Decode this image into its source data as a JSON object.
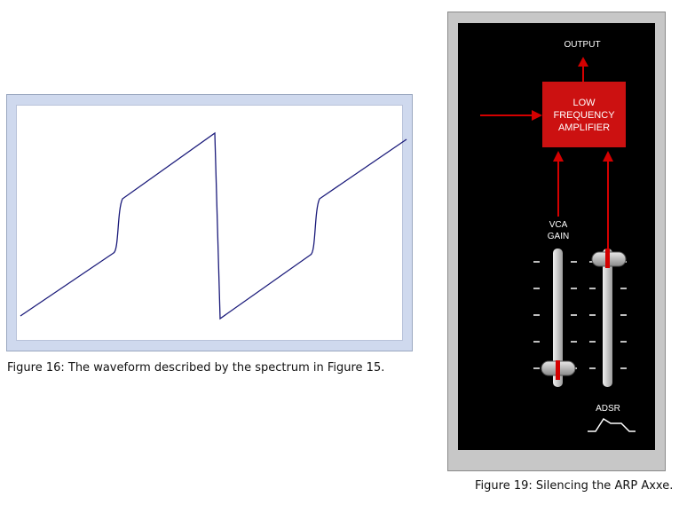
{
  "figure16": {
    "caption": "Figure 16: The waveform described by the spectrum in Figure 15."
  },
  "figure19": {
    "caption": "Figure 19: Silencing the ARP Axxe.",
    "output_label": "OUTPUT",
    "amp_label_1": "LOW",
    "amp_label_2": "FREQUENCY",
    "amp_label_3": "AMPLIFIER",
    "vca_label_1": "VCA",
    "vca_label_2": "GAIN",
    "adsr_label": "ADSR",
    "colors": {
      "panel": "#000000",
      "signal": "#d40000",
      "amp_box": "#cc1111",
      "wave": "#1a1a7a"
    },
    "sliders": [
      {
        "name": "VCA GAIN",
        "level": 0.0
      },
      {
        "name": "ADSR",
        "level": 1.0
      }
    ]
  }
}
